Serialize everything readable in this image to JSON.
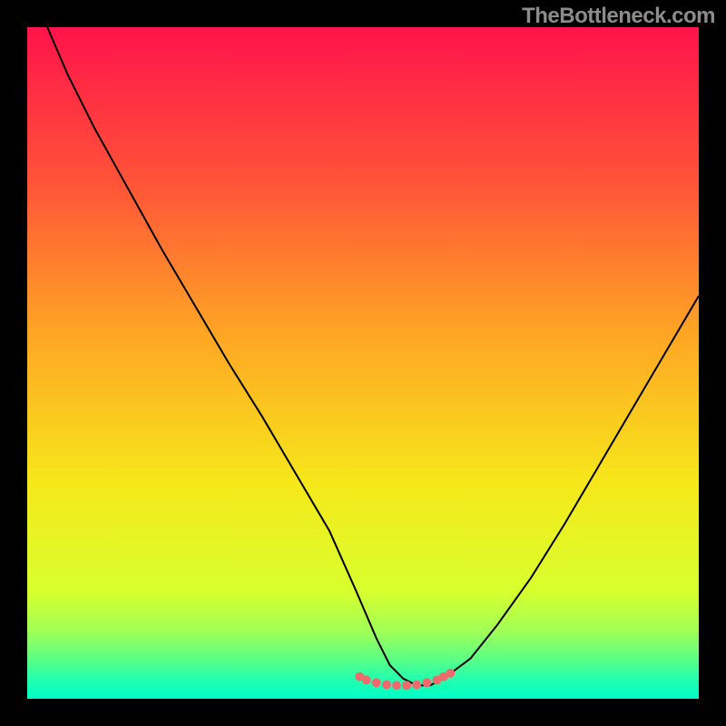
{
  "watermark": "TheBottleneck.com",
  "chart_data": {
    "type": "line",
    "title": "",
    "xlabel": "",
    "ylabel": "",
    "xlim": [
      0,
      100
    ],
    "ylim": [
      0,
      100
    ],
    "grid": false,
    "legend": false,
    "gradient_stops": [
      {
        "offset": 0,
        "color": "#ff134b"
      },
      {
        "offset": 0.23,
        "color": "#ff5338"
      },
      {
        "offset": 0.45,
        "color": "#ffa325"
      },
      {
        "offset": 0.68,
        "color": "#f6e81a"
      },
      {
        "offset": 0.84,
        "color": "#d8ff2e"
      },
      {
        "offset": 0.9,
        "color": "#9fff57"
      },
      {
        "offset": 0.94,
        "color": "#5dff84"
      },
      {
        "offset": 0.97,
        "color": "#24ffad"
      },
      {
        "offset": 1.0,
        "color": "#00ffc8"
      }
    ],
    "series": [
      {
        "name": "bottleneck-curve",
        "color": "#000000",
        "x": [
          3,
          6,
          10,
          15,
          20,
          25,
          30,
          35,
          40,
          45,
          49,
          52,
          54,
          56,
          58,
          60,
          62,
          66,
          70,
          75,
          80,
          85,
          90,
          95,
          100
        ],
        "y": [
          100,
          93,
          85,
          76,
          67,
          58.5,
          50,
          42,
          33.5,
          25,
          16,
          9,
          5,
          3,
          2,
          2,
          3,
          6,
          11,
          18,
          26,
          34.5,
          43,
          51.5,
          60
        ]
      }
    ],
    "markers": {
      "name": "optimal-range-marker",
      "color": "#ee6a6c",
      "radius_px": 5,
      "x": [
        49.5,
        50.5,
        52,
        53.5,
        55,
        56.5,
        58,
        59.5,
        61,
        62,
        63
      ],
      "y": [
        3.3,
        2.8,
        2.4,
        2.1,
        2.0,
        2.0,
        2.1,
        2.4,
        2.8,
        3.3,
        3.8
      ]
    }
  }
}
